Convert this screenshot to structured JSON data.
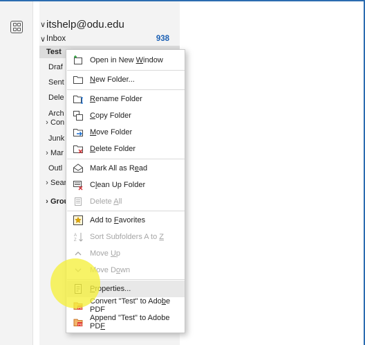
{
  "account": {
    "email": "itshelp@odu.edu"
  },
  "inbox": {
    "label": "Inbox",
    "count": "938"
  },
  "folders": [
    {
      "label": "Test"
    },
    {
      "label": "Draf"
    },
    {
      "label": "Sent"
    },
    {
      "label": "Dele"
    },
    {
      "label": "Arch"
    },
    {
      "label": "Con"
    },
    {
      "label": "Junk"
    },
    {
      "label": "Mar"
    },
    {
      "label": "Outl"
    },
    {
      "label": "Sear"
    },
    {
      "label": "Grou"
    }
  ],
  "menu": {
    "open_new_window": {
      "pre": "Open in New ",
      "ul": "W",
      "post": "indow"
    },
    "new_folder": {
      "pre": "",
      "ul": "N",
      "post": "ew Folder..."
    },
    "rename_folder": {
      "pre": "",
      "ul": "R",
      "post": "ename Folder"
    },
    "copy_folder": {
      "pre": "",
      "ul": "C",
      "post": "opy Folder"
    },
    "move_folder": {
      "pre": "",
      "ul": "M",
      "post": "ove Folder"
    },
    "delete_folder": {
      "pre": "",
      "ul": "D",
      "post": "elete Folder"
    },
    "mark_all_read": {
      "pre": "Mark All as R",
      "ul": "e",
      "post": "ad"
    },
    "clean_up_folder": {
      "pre": "C",
      "ul": "l",
      "post": "ean Up Folder"
    },
    "delete_all": {
      "pre": "Delete ",
      "ul": "A",
      "post": "ll"
    },
    "add_favorites": {
      "pre": "Add to ",
      "ul": "F",
      "post": "avorites"
    },
    "sort_subfolders": {
      "pre": "Sort Subfolders A to ",
      "ul": "Z",
      "post": ""
    },
    "move_up": {
      "pre": "Move ",
      "ul": "U",
      "post": "p"
    },
    "move_down": {
      "pre": "Move D",
      "ul": "o",
      "post": "wn"
    },
    "properties": {
      "pre": "",
      "ul": "P",
      "post": "roperties..."
    },
    "convert_pdf": {
      "pre": "Convert \"Test\" to Ado",
      "ul": "b",
      "post": "e PDF"
    },
    "append_pdf": {
      "pre": "Append \"Test\" to Adobe PD",
      "ul": "F",
      "post": ""
    }
  },
  "colors": {
    "accent": "#2b6cb0",
    "count": "#1a5fb4",
    "highlight": "#f5f03c"
  }
}
